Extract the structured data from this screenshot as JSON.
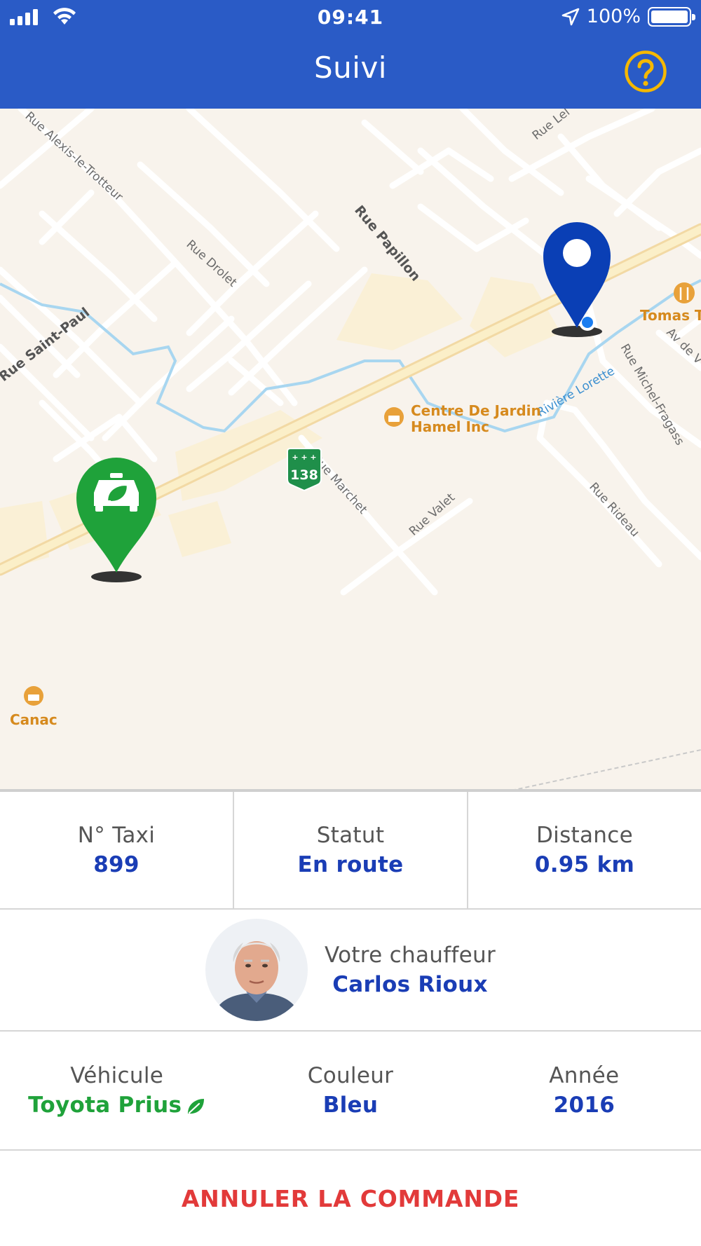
{
  "status_bar": {
    "time": "09:41",
    "battery": "100%"
  },
  "header": {
    "title": "Suivi",
    "help_icon": "question-circle-icon"
  },
  "map": {
    "streets": [
      "Rue Alexis-le-Trotteur",
      "Rue Drolet",
      "Rue Papillon",
      "Rue Saint-Paul",
      "Rue Lel",
      "Rue Marchet",
      "Rue Valet",
      "Rue Rideau",
      "Rue Michel-Fragass",
      "Av de V"
    ],
    "river": "Rivière Lorette",
    "route_shield": "138",
    "pois": [
      {
        "name": "Centre De Jardin",
        "name2": "Hamel Inc",
        "icon": "shopping-bag-icon"
      },
      {
        "name": "Canac",
        "icon": "shopping-bag-icon"
      },
      {
        "name": "Tomas T",
        "icon": "restaurant-icon"
      }
    ],
    "markers": {
      "taxi": "taxi-marker-icon",
      "destination": "destination-pin-icon"
    },
    "colors": {
      "taxi": "#1fa23a",
      "destination": "#0a3fb5",
      "poi": "#e8a13a"
    }
  },
  "trip": {
    "taxi_label": "N° Taxi",
    "taxi_value": "899",
    "status_label": "Statut",
    "status_value": "En route",
    "distance_label": "Distance",
    "distance_value": "0.95 km"
  },
  "driver": {
    "label": "Votre chauffeur",
    "name": "Carlos Rioux"
  },
  "vehicle": {
    "vehicle_label": "Véhicule",
    "vehicle_value": "Toyota Prius",
    "eco_icon": "leaf-icon",
    "color_label": "Couleur",
    "color_value": "Bleu",
    "year_label": "Année",
    "year_value": "2016"
  },
  "cancel": {
    "label": "ANNULER LA COMMANDE"
  },
  "colors": {
    "header": "#2a5bc6",
    "accent": "#1a3db5",
    "green": "#1fa23a",
    "cancel": "#e23a3a",
    "help": "#f5b800"
  }
}
